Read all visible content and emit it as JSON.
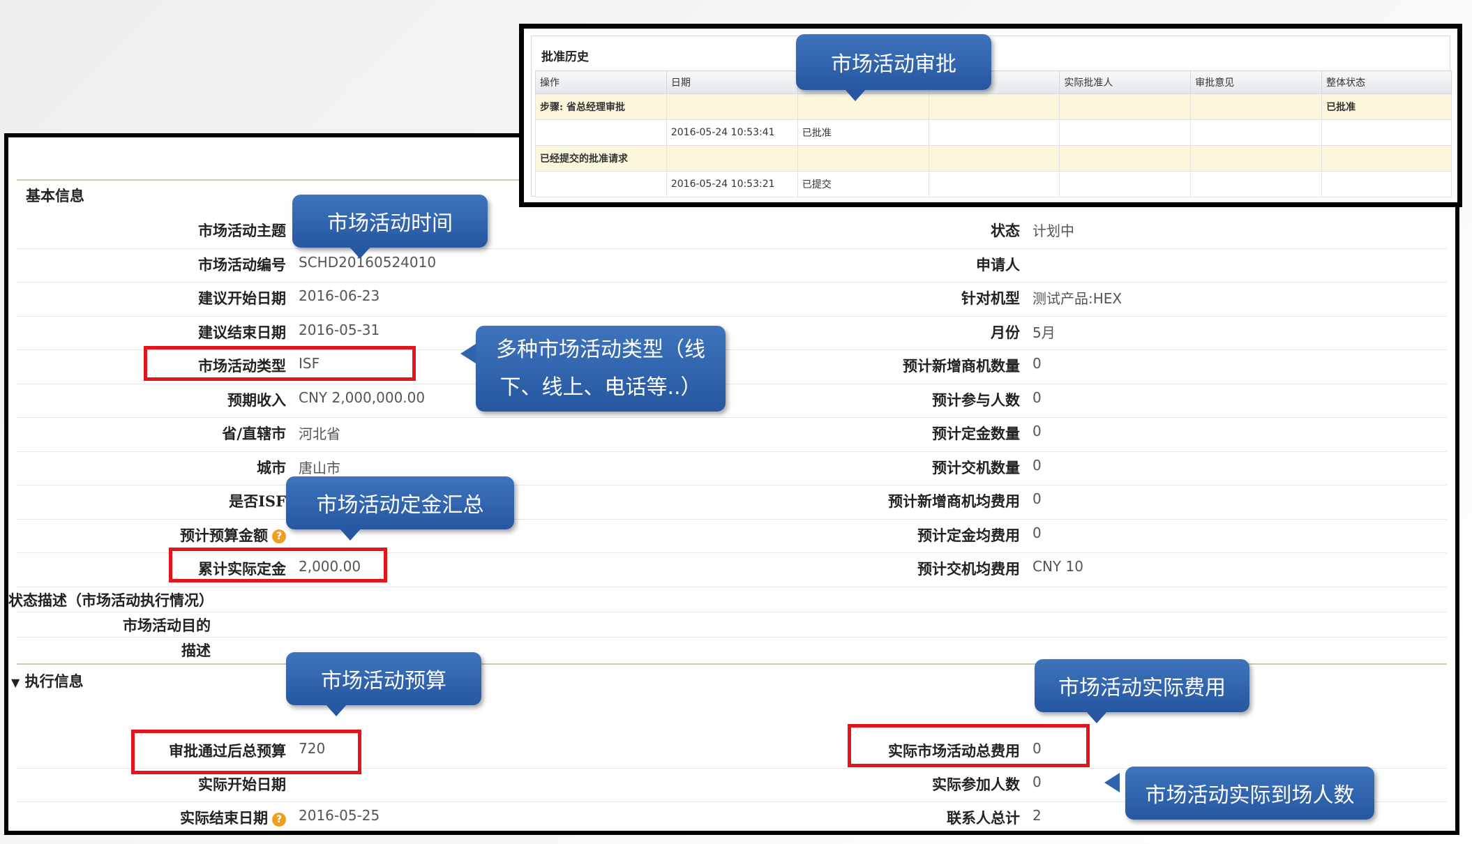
{
  "approval": {
    "title": "批准历史",
    "columns": [
      "操作",
      "日期",
      "",
      "",
      "实际批准人",
      "审批意见",
      "整体状态"
    ],
    "rows": [
      {
        "type": "step",
        "cells": [
          "步骤: 省总经理审批",
          "",
          "",
          "",
          "",
          "",
          "已批准"
        ]
      },
      {
        "type": "plain",
        "cells": [
          "",
          "2016-05-24 10:53:41",
          "已批准",
          "",
          "",
          "",
          ""
        ]
      },
      {
        "type": "step",
        "cells": [
          "已经提交的批准请求",
          "",
          "",
          "",
          "",
          "",
          ""
        ]
      },
      {
        "type": "plain",
        "cells": [
          "",
          "2016-05-24 10:53:21",
          "已提交",
          "",
          "",
          "",
          ""
        ]
      }
    ]
  },
  "basic": {
    "title": "基本信息",
    "left": [
      {
        "label": "市场活动主题",
        "value": ""
      },
      {
        "label": "市场活动编号",
        "value": "SCHD20160524010"
      },
      {
        "label": "建议开始日期",
        "value": "2016-06-23"
      },
      {
        "label": "建议结束日期",
        "value": "2016-05-31"
      },
      {
        "label": "市场活动类型",
        "value": "ISF"
      },
      {
        "label": "预期收入",
        "value": "CNY 2,000,000.00"
      },
      {
        "label": "省/直辖市",
        "value": "河北省"
      },
      {
        "label": "城市",
        "value": "唐山市"
      },
      {
        "label": "是否ISF",
        "value": ""
      },
      {
        "label": "预计预算金额",
        "value": ""
      },
      {
        "label": "累计实际定金",
        "value": "2,000.00"
      }
    ],
    "right": [
      {
        "label": "状态",
        "value": "计划中"
      },
      {
        "label": "申请人",
        "value": ""
      },
      {
        "label": "针对机型",
        "value": "测试产品:HEX"
      },
      {
        "label": "月份",
        "value": "5月"
      },
      {
        "label": "预计新增商机数量",
        "value": "0"
      },
      {
        "label": "预计参与人数",
        "value": "0"
      },
      {
        "label": "预计定金数量",
        "value": "0"
      },
      {
        "label": "预计交机数量",
        "value": "0"
      },
      {
        "label": "预计新增商机均费用",
        "value": "0"
      },
      {
        "label": "预计定金均费用",
        "value": "0"
      },
      {
        "label": "预计交机均费用",
        "value": "CNY 10"
      }
    ],
    "status_desc": "状态描述（市场活动执行情况）",
    "purpose_label": "市场活动目的",
    "desc_label": "描述"
  },
  "exec": {
    "title": "执行信息",
    "left": [
      {
        "label": "审批通过后总预算",
        "value": "720"
      },
      {
        "label": "实际开始日期",
        "value": ""
      },
      {
        "label": "实际结束日期",
        "value": "2016-05-25"
      }
    ],
    "right": [
      {
        "label": "实际市场活动总费用",
        "value": "0"
      },
      {
        "label": "实际参加人数",
        "value": "0"
      },
      {
        "label": "联系人总计",
        "value": "2"
      }
    ]
  },
  "help_glyph": "?",
  "collapse_glyph": "▼",
  "callouts": {
    "approval": "市场活动审批",
    "time": "市场活动时间",
    "types_line1": "多种市场活动类型（线",
    "types_line2": "下、线上、电话等..）",
    "deposit": "市场活动定金汇总",
    "budget": "市场活动预算",
    "actual_cost": "市场活动实际费用",
    "attendance": "市场活动实际到场人数"
  },
  "colors": {
    "callout_blue": "#2f64ad",
    "highlight_red": "#e3141b",
    "section_line": "#cfcca8",
    "step_row": "#fbf6dc"
  }
}
